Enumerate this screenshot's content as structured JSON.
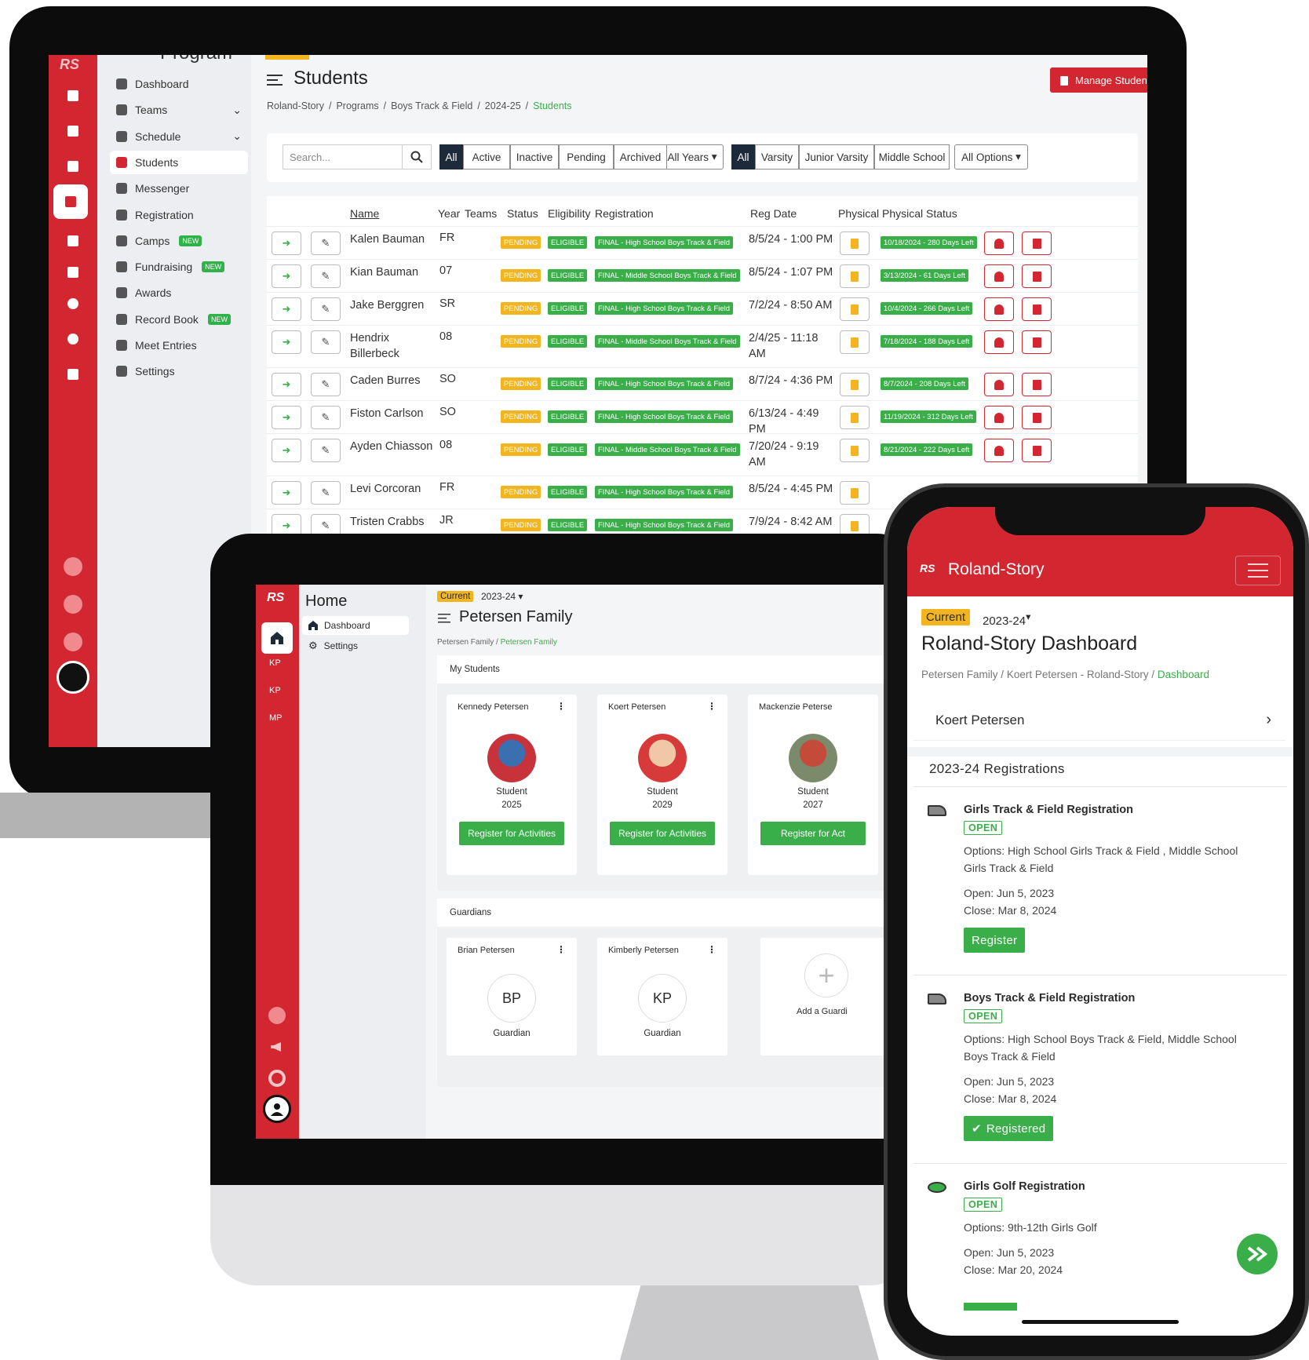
{
  "desktop": {
    "sidebar_heading": "Program",
    "nav": [
      {
        "label": "Dashboard",
        "icon": "dashboard-icon"
      },
      {
        "label": "Teams",
        "icon": "teams-icon"
      },
      {
        "label": "Schedule",
        "icon": "calendar-icon"
      },
      {
        "label": "Students",
        "icon": "students-icon"
      },
      {
        "label": "Messenger",
        "icon": "messenger-icon"
      },
      {
        "label": "Registration",
        "icon": "registration-icon"
      },
      {
        "label": "Camps",
        "icon": "camps-icon",
        "badge": "NEW"
      },
      {
        "label": "Fundraising",
        "icon": "fundraising-icon",
        "badge": "NEW"
      },
      {
        "label": "Awards",
        "icon": "awards-icon"
      },
      {
        "label": "Record Book",
        "icon": "record-book-icon",
        "badge": "NEW"
      },
      {
        "label": "Meet Entries",
        "icon": "meet-entries-icon"
      },
      {
        "label": "Settings",
        "icon": "gear-icon"
      }
    ],
    "page_title": "Students",
    "manage_button": "Manage Students",
    "breadcrumb": [
      "Roland-Story",
      "Programs",
      "Boys Track & Field",
      "2024-25",
      "Students"
    ],
    "search_placeholder": "Search...",
    "status_filters": [
      "All",
      "Active",
      "Inactive",
      "Pending",
      "Archived"
    ],
    "years_dropdown": "All Years",
    "level_filters": [
      "All",
      "Varsity",
      "Junior Varsity",
      "Middle School"
    ],
    "options_dropdown": "All Options",
    "columns": [
      "Name",
      "Year",
      "Teams",
      "Status",
      "Eligibility",
      "Registration",
      "Reg Date",
      "Physical",
      "Physical Status"
    ],
    "rows": [
      {
        "name": "Kalen Bauman",
        "year": "FR",
        "status": "PENDING",
        "elig": "ELIGIBLE",
        "reg": "FINAL - High School Boys Track & Field",
        "date": "8/5/24 - 1:00 PM",
        "phys": "10/18/2024 - 280 Days Left"
      },
      {
        "name": "Kian Bauman",
        "year": "07",
        "status": "PENDING",
        "elig": "ELIGIBLE",
        "reg": "FINAL - Middle School Boys Track & Field",
        "date": "8/5/24 - 1:07 PM",
        "phys": "3/13/2024 - 61 Days Left"
      },
      {
        "name": "Jake Berggren",
        "year": "SR",
        "status": "PENDING",
        "elig": "ELIGIBLE",
        "reg": "FINAL - High School Boys Track & Field",
        "date": "7/2/24 - 8:50 AM",
        "phys": "10/4/2024 - 266 Days Left"
      },
      {
        "name": "Hendrix Billerbeck",
        "year": "08",
        "status": "PENDING",
        "elig": "ELIGIBLE",
        "reg": "FINAL - Middle School Boys Track & Field",
        "date": "2/4/25 - 11:18 AM",
        "phys": "7/18/2024 - 188 Days Left"
      },
      {
        "name": "Caden Burres",
        "year": "SO",
        "status": "PENDING",
        "elig": "ELIGIBLE",
        "reg": "FINAL - High School Boys Track & Field",
        "date": "8/7/24 - 4:36 PM",
        "phys": "8/7/2024 - 208 Days Left"
      },
      {
        "name": "Fiston Carlson",
        "year": "SO",
        "status": "PENDING",
        "elig": "ELIGIBLE",
        "reg": "FINAL - High School Boys Track & Field",
        "date": "6/13/24 - 4:49 PM",
        "phys": "11/19/2024 - 312 Days Left"
      },
      {
        "name": "Ayden Chiasson",
        "year": "08",
        "status": "PENDING",
        "elig": "ELIGIBLE",
        "reg": "FINAL - Middle School Boys Track & Field",
        "date": "7/20/24 - 9:19 AM",
        "phys": "8/21/2024 - 222 Days Left"
      },
      {
        "name": "Levi Corcoran",
        "year": "FR",
        "status": "PENDING",
        "elig": "ELIGIBLE",
        "reg": "FINAL - High School Boys Track & Field",
        "date": "8/5/24 - 4:45 PM",
        "phys": ""
      },
      {
        "name": "Tristen Crabbs",
        "year": "JR",
        "status": "PENDING",
        "elig": "ELIGIBLE",
        "reg": "FINAL - High School Boys Track & Field",
        "date": "7/9/24 - 8:42 AM",
        "phys": ""
      }
    ]
  },
  "tablet": {
    "rail_initials": [
      "KP",
      "KP",
      "MP"
    ],
    "sidebar_heading": "Home",
    "nav": [
      "Dashboard",
      "Settings"
    ],
    "current_badge": "Current",
    "season": "2023-24",
    "page_title": "Petersen Family",
    "breadcrumb": [
      "Petersen Family",
      "Petersen Family"
    ],
    "students_heading": "My Students",
    "students": [
      {
        "name": "Kennedy Petersen",
        "role": "Student",
        "year": "2025",
        "button": "Register for Activities"
      },
      {
        "name": "Koert Petersen",
        "role": "Student",
        "year": "2029",
        "button": "Register for Activities"
      },
      {
        "name": "Mackenzie Peterse",
        "role": "Student",
        "year": "2027",
        "button": "Register for Act"
      }
    ],
    "guardians_heading": "Guardians",
    "guardians": [
      {
        "name": "Brian Petersen",
        "initials": "BP",
        "role": "Guardian"
      },
      {
        "name": "Kimberly Petersen",
        "initials": "KP",
        "role": "Guardian"
      }
    ],
    "add_guardian": "Add a Guardi"
  },
  "phone": {
    "org": "Roland-Story",
    "current_badge": "Current",
    "season": "2023-24",
    "title": "Roland-Story Dashboard",
    "breadcrumb": [
      "Petersen Family",
      "Koert Petersen - Roland-Story",
      "Dashboard"
    ],
    "student_select": "Koert Petersen",
    "registrations_heading": "2023-24 Registrations",
    "registrations": [
      {
        "title": "Girls Track & Field Registration",
        "badge": "OPEN",
        "options1": "Options: High School Girls Track & Field , Middle School",
        "options2": "Girls Track & Field",
        "open": "Open: Jun 5, 2023",
        "close": "Close: Mar 8, 2024",
        "button": "Register"
      },
      {
        "title": "Boys Track & Field Registration",
        "badge": "OPEN",
        "options1": "Options: High School Boys Track & Field, Middle School",
        "options2": "Boys Track & Field",
        "open": "Open: Jun 5, 2023",
        "close": "Close: Mar 8, 2024",
        "button": "Registered"
      },
      {
        "title": "Girls Golf Registration",
        "badge": "OPEN",
        "options1": "Options: 9th-12th Girls Golf",
        "options2": "",
        "open": "Open: Jun 5, 2023",
        "close": "Close: Mar 20, 2024",
        "button": ""
      }
    ]
  },
  "colors": {
    "brand_red": "#d22630",
    "success_green": "#3aae49",
    "pending_yellow": "#f2b51f",
    "dark_navy": "#1c2a3a"
  }
}
